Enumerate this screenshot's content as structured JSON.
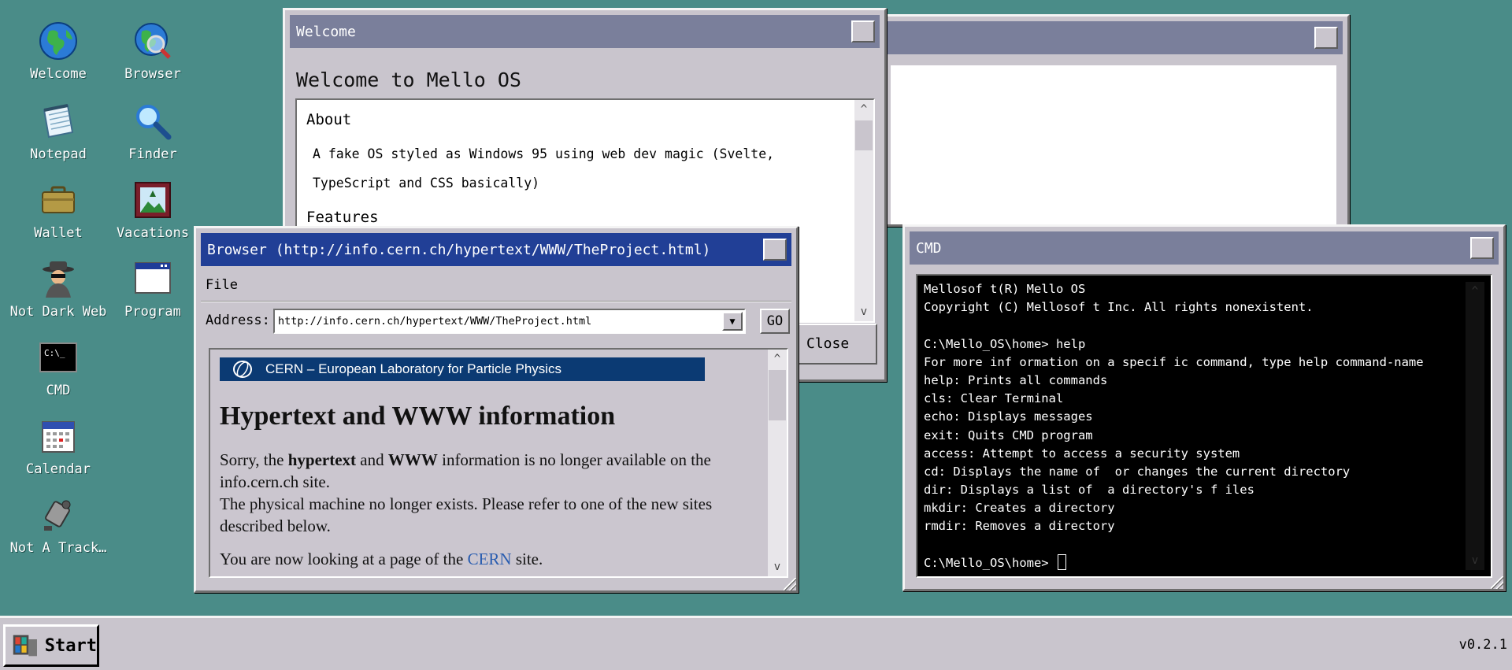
{
  "desktop": {
    "icons": [
      {
        "label": "Welcome",
        "icon": "globe-icon"
      },
      {
        "label": "Browser",
        "icon": "globe-magnifier-icon"
      },
      {
        "label": "Notepad",
        "icon": "notepad-icon"
      },
      {
        "label": "Finder",
        "icon": "magnifier-icon"
      },
      {
        "label": "Wallet",
        "icon": "briefcase-icon"
      },
      {
        "label": "Vacations",
        "icon": "picture-icon"
      },
      {
        "label": "Not Dark Web",
        "icon": "spy-icon"
      },
      {
        "label": "Program",
        "icon": "program-window-icon"
      },
      {
        "label": "CMD",
        "icon": "terminal-icon"
      },
      {
        "label": "Calendar",
        "icon": "calendar-icon"
      },
      {
        "label": "Not A Track…",
        "icon": "camera-icon"
      }
    ]
  },
  "welcome_window": {
    "title": "Welcome",
    "heading": "Welcome to Mello OS",
    "about_heading": "About",
    "about_text": "A fake OS styled as Windows 95 using web dev magic (Svelte, TypeScript and CSS basically)",
    "features_heading": "Features",
    "close_label": "Close"
  },
  "browser_window": {
    "title": "Browser (http://info.cern.ch/hypertext/WWW/TheProject.html)",
    "menu_file": "File",
    "address_label": "Address:",
    "address_value": "http://info.cern.ch/hypertext/WWW/TheProject.html",
    "go_label": "GO",
    "page": {
      "banner": "CERN – European Laboratory for Particle Physics",
      "heading": "Hypertext and WWW information",
      "para1_pre": "Sorry, the ",
      "para1_b1": "hypertext",
      "para1_mid": " and ",
      "para1_b2": "WWW",
      "para1_post": " information is no longer available on the info.cern.ch site.",
      "para1_line2": "The physical machine no longer exists. Please refer to one of the new sites described below.",
      "para2_pre": "You are now looking at a page of the ",
      "para2_link": "CERN",
      "para2_post": " site."
    }
  },
  "cmd_window": {
    "title": "CMD",
    "lines": [
      "Mellosof t(R) Mello OS",
      "Copyright (C) Mellosof t Inc. All rights nonexistent.",
      "",
      "C:\\Mello_OS\\home> help",
      "For more inf ormation on a specif ic command, type help command-name",
      "help: Prints all commands",
      "cls: Clear Terminal",
      "echo: Displays messages",
      "exit: Quits CMD program",
      "access: Attempt to access a security system",
      "cd: Displays the name of  or changes the current directory",
      "dir: Displays a list of  a directory's f iles",
      "mkdir: Creates a directory",
      "rmdir: Removes a directory",
      ""
    ],
    "prompt": "C:\\Mello_OS\\home> "
  },
  "taskbar": {
    "start_label": "Start",
    "version": "v0.2.1"
  },
  "colors": {
    "desktop": "#4a8c88",
    "active_title": "#213f96",
    "inactive_title": "#7a7f9b",
    "window_face": "#c9c5cd",
    "cern_banner": "#0b3a73"
  }
}
